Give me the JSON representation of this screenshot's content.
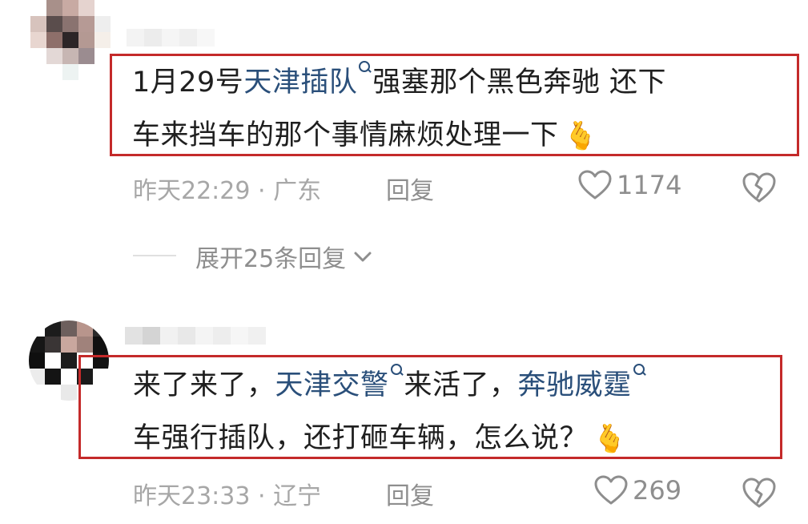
{
  "colors": {
    "highlight_box": "#c42a2a",
    "topic_link": "#2a4f7a",
    "meta_text": "#a7a7a7",
    "action_text": "#8e8e8e"
  },
  "comments": [
    {
      "avatar_icon": "pixelated-avatar",
      "text_line1_a": "1月29号",
      "topic1": "天津插队",
      "text_line1_b": "强塞那个黑色奔驰 还下",
      "text_line2": "车来挡车的那个事情麻烦处理一下",
      "emoji": "🫰",
      "time_location": "昨天22:29 · 广东",
      "reply_label": "回复",
      "like_count": "1174",
      "like_icon": "heart-outline-icon",
      "dislike_icon": "broken-heart-icon",
      "expand_label": "展开25条回复",
      "expand_icon": "chevron-down-icon"
    },
    {
      "avatar_icon": "pixelated-avatar",
      "text_line1_a": "来了来了，",
      "topic1": "天津交警",
      "text_line1_b": "来活了，",
      "topic2": "奔驰威霆",
      "text_line2": "车强行插队，还打砸车辆，怎么说？",
      "emoji": "🫰",
      "time_location": "昨天23:33 · 辽宁",
      "reply_label": "回复",
      "like_count": "269",
      "like_icon": "heart-outline-icon",
      "dislike_icon": "broken-heart-icon"
    }
  ]
}
